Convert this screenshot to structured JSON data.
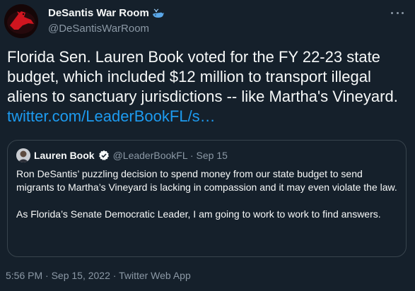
{
  "author": {
    "name": "DeSantis War Room",
    "handle": "@DeSantisWarRoom",
    "emoji_icon": "spouting-whale-icon"
  },
  "tweet": {
    "text": "Florida Sen. Lauren Book voted for the FY 22-23 state budget, which included $12 million to transport illegal aliens to sanctuary jurisdictions -- like Martha's Vineyard. ",
    "link": "twitter.com/LeaderBookFL/s…"
  },
  "quoted": {
    "name": "Lauren Book",
    "handle_date": "@LeaderBookFL · Sep 15",
    "paragraphs": [
      "Ron DeSantis’ puzzling decision to spend money from our state budget to send migrants to Martha’s Vineyard is lacking in compassion and it may even violate the law.",
      "As Florida’s Senate Democratic Leader, I am going to work to work to find answers."
    ]
  },
  "meta": {
    "timestamp": "5:56 PM · Sep 15, 2022 · Twitter Web App"
  },
  "colors": {
    "background": "#15202b",
    "text": "#f7f9f9",
    "muted": "#8b98a5",
    "link": "#1d9bf0",
    "border": "#38444d"
  }
}
